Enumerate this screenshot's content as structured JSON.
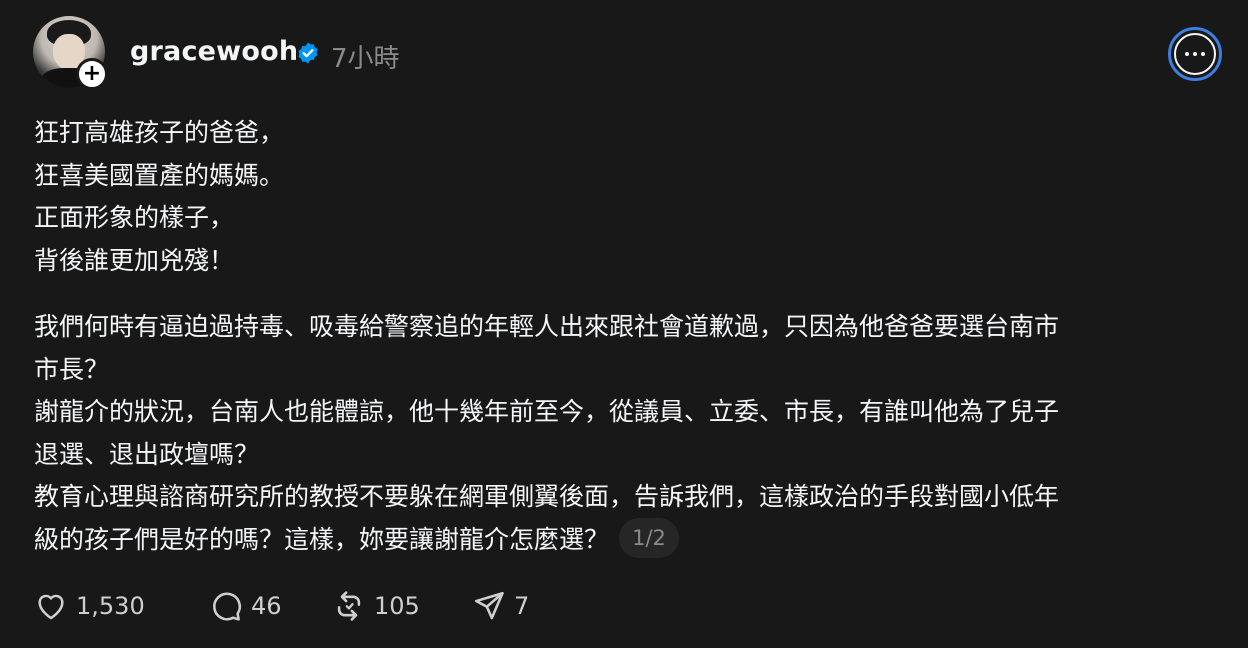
{
  "post": {
    "username": "gracewooh",
    "timestamp": "7小時",
    "follow_symbol": "+",
    "paragraph1": [
      "狂打高雄孩子的爸爸，",
      "狂喜美國置產的媽媽。",
      "正面形象的樣子，",
      "背後誰更加兇殘！"
    ],
    "paragraph2": [
      "我們何時有逼迫過持毒、吸毒給警察追的年輕人出來跟社會道歉過，只因為他爸爸要選台南市",
      "市長？",
      "謝龍介的狀況，台南人也能體諒，他十幾年前至今，從議員、立委、市長，有誰叫他為了兒子",
      "退選、退出政壇嗎？",
      "教育心理與諮商研究所的教授不要躲在網軍側翼後面，告訴我們，這樣政治的手段對國小低年",
      "級的孩子們是好的嗎？這樣，妳要讓謝龍介怎麼選？"
    ],
    "page_indicator": "1/2",
    "stats": {
      "likes": "1,530",
      "replies": "46",
      "reposts": "105",
      "shares": "7"
    }
  },
  "icons": {
    "verified": "verified-badge-icon",
    "more": "more-options-icon",
    "like": "heart-icon",
    "reply": "comment-icon",
    "repost": "repost-icon",
    "share": "send-icon"
  },
  "colors": {
    "background": "#181818",
    "text": "#f3f5f7",
    "muted": "#8a8a8a",
    "verified": "#0095f6",
    "focus_ring": "#3d7fe0"
  }
}
